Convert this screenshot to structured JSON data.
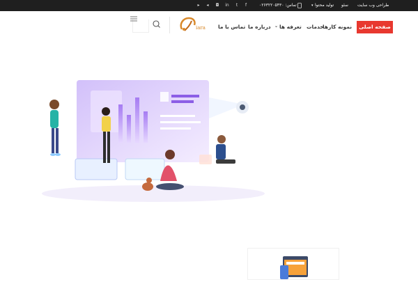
{
  "topbar": {
    "site_design": "طراحی وب سایت",
    "seo": "سئو",
    "content_production": "تولید محتوا",
    "contact": "تماس: ۰۲۶۳۲۲۰۵۴۳۰",
    "social_icons": [
      "facebook-icon",
      "twitter-icon",
      "linkedin-icon",
      "instagram-icon",
      "telegram-icon",
      "twitter-icon",
      "vimeo-icon",
      "youtube-icon"
    ]
  },
  "nav": {
    "home": "صفحه اصلی",
    "portfolio": "نمونه کارها",
    "services": "خدمات",
    "pricing": "تعرفه ها",
    "about": "درباره ما",
    "contact": "تماس با ما",
    "logo_text": "iara"
  },
  "colors": {
    "accent": "#e8382f",
    "topbar": "#1f1f1f",
    "brand": "#d9892a",
    "hero_purple": "#c7b6f6"
  }
}
